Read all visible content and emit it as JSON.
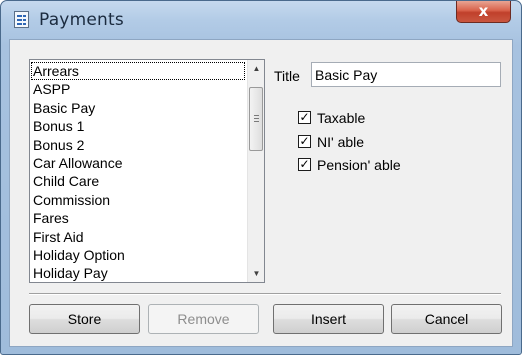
{
  "window": {
    "title": "Payments",
    "close_glyph": "x"
  },
  "list": {
    "items": [
      "Arrears",
      "ASPP",
      "Basic Pay",
      "Bonus 1",
      "Bonus 2",
      "Car Allowance",
      "Child Care",
      "Commission",
      "Fares",
      "First Aid",
      "Holiday Option",
      "Holiday Pay"
    ],
    "focused_index": 0,
    "scroll_up_glyph": "▲",
    "scroll_down_glyph": "▼"
  },
  "form": {
    "title_label": "Title",
    "title_value": "Basic Pay",
    "checks": [
      {
        "label": "Taxable",
        "checked": true
      },
      {
        "label": "NI' able",
        "checked": true
      },
      {
        "label": "Pension' able",
        "checked": true
      }
    ],
    "check_glyph": "✓"
  },
  "buttons": {
    "store": "Store",
    "remove": "Remove",
    "insert": "Insert",
    "cancel": "Cancel"
  }
}
